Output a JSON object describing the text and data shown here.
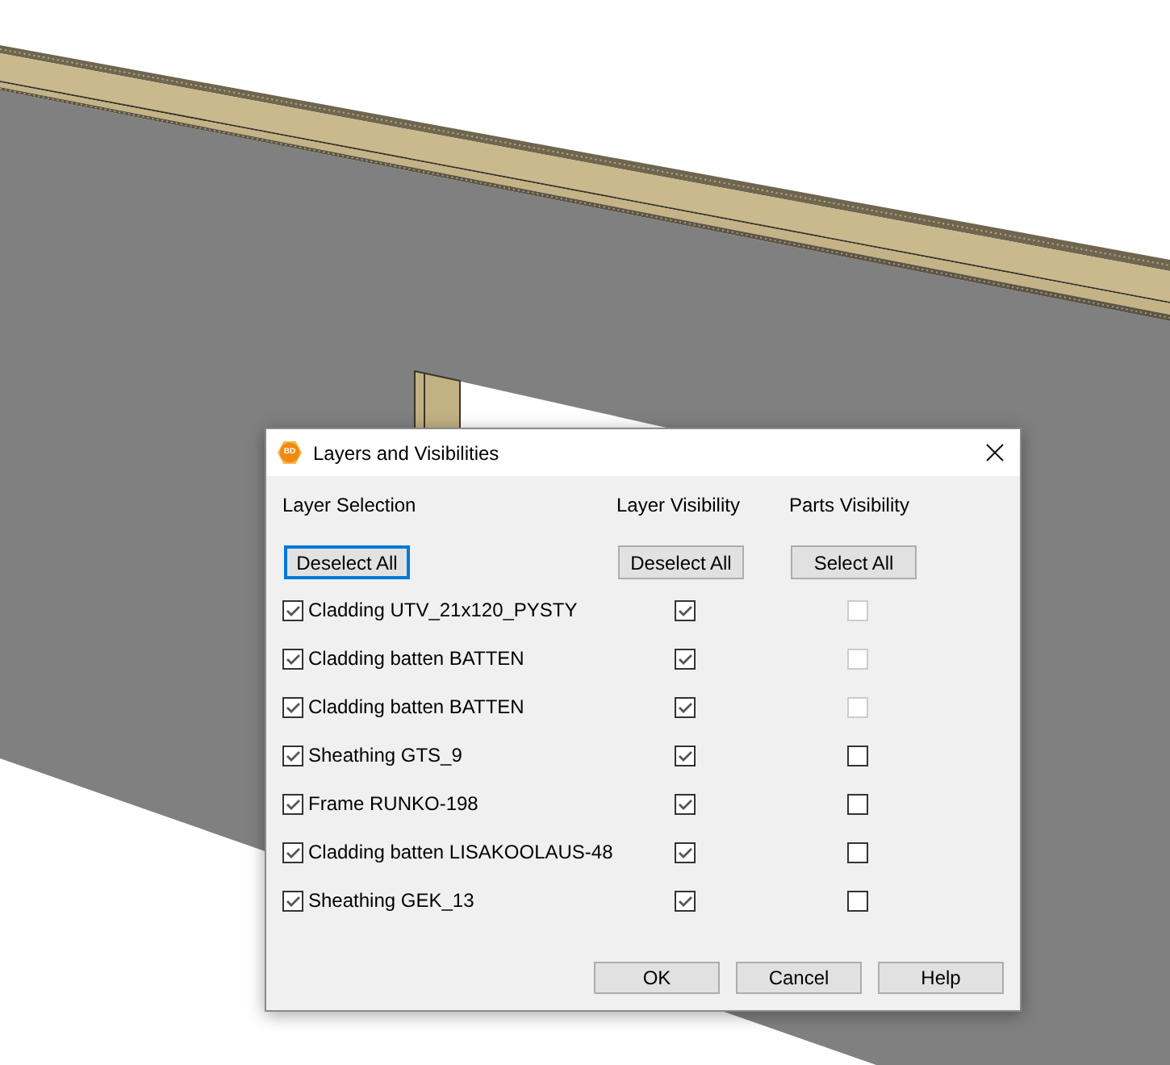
{
  "window": {
    "title": "Layers and Visibilities",
    "logo_text": "BD"
  },
  "columns": [
    {
      "heading": "Layer Selection",
      "button": {
        "label": "Deselect All",
        "focused": true
      }
    },
    {
      "heading": "Layer Visibility",
      "button": {
        "label": "Deselect All",
        "focused": false
      }
    },
    {
      "heading": "Parts Visibility",
      "button": {
        "label": "Select All",
        "focused": false
      }
    }
  ],
  "layers": [
    {
      "name": "Cladding UTV_21x120_PYSTY",
      "selection": {
        "checked": true,
        "disabled": false
      },
      "layer_visibility": {
        "checked": true,
        "disabled": false
      },
      "parts_visibility": {
        "checked": false,
        "disabled": true
      }
    },
    {
      "name": "Cladding batten BATTEN",
      "selection": {
        "checked": true,
        "disabled": false
      },
      "layer_visibility": {
        "checked": true,
        "disabled": false
      },
      "parts_visibility": {
        "checked": false,
        "disabled": true
      }
    },
    {
      "name": "Cladding batten BATTEN",
      "selection": {
        "checked": true,
        "disabled": false
      },
      "layer_visibility": {
        "checked": true,
        "disabled": false
      },
      "parts_visibility": {
        "checked": false,
        "disabled": true
      }
    },
    {
      "name": "Sheathing GTS_9",
      "selection": {
        "checked": true,
        "disabled": false
      },
      "layer_visibility": {
        "checked": true,
        "disabled": false
      },
      "parts_visibility": {
        "checked": false,
        "disabled": false
      }
    },
    {
      "name": "Frame RUNKO-198",
      "selection": {
        "checked": true,
        "disabled": false
      },
      "layer_visibility": {
        "checked": true,
        "disabled": false
      },
      "parts_visibility": {
        "checked": false,
        "disabled": false
      }
    },
    {
      "name": "Cladding batten LISAKOOLAUS-48",
      "selection": {
        "checked": true,
        "disabled": false
      },
      "layer_visibility": {
        "checked": true,
        "disabled": false
      },
      "parts_visibility": {
        "checked": false,
        "disabled": false
      }
    },
    {
      "name": "Sheathing GEK_13",
      "selection": {
        "checked": true,
        "disabled": false
      },
      "layer_visibility": {
        "checked": true,
        "disabled": false
      },
      "parts_visibility": {
        "checked": false,
        "disabled": false
      }
    }
  ],
  "buttons": [
    "OK",
    "Cancel",
    "Help"
  ]
}
